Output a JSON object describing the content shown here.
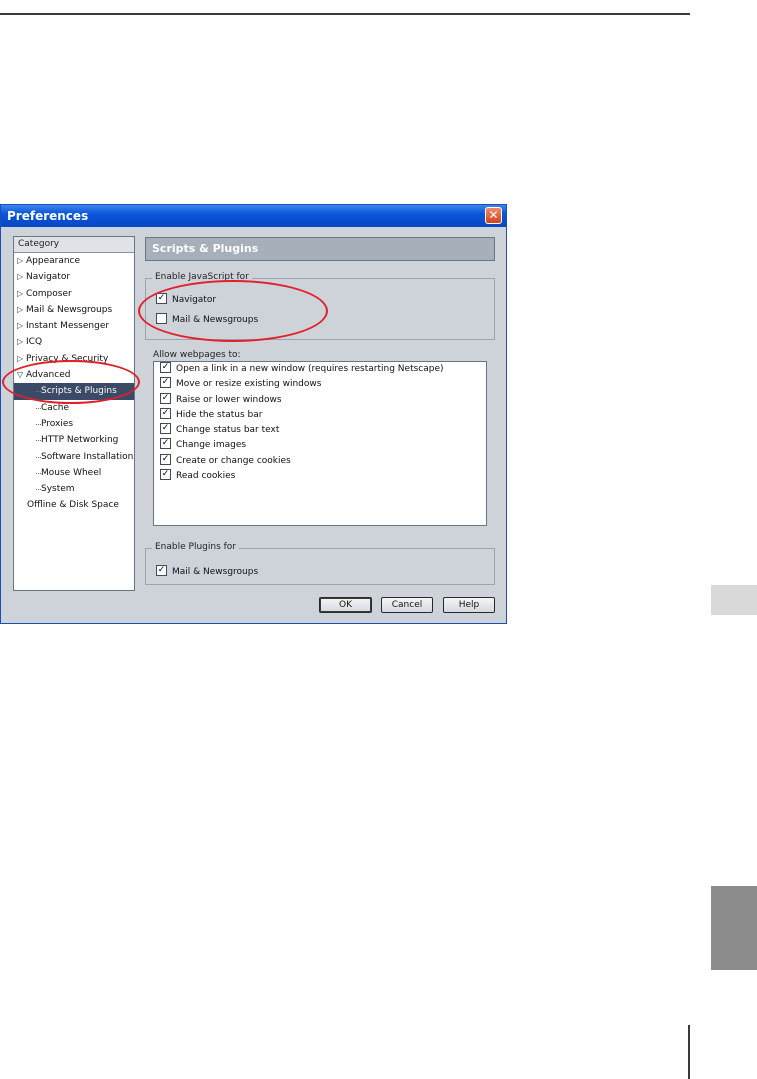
{
  "window": {
    "title": "Preferences"
  },
  "category": {
    "header": "Category",
    "items": [
      {
        "label": "Appearance",
        "kind": "collapsed"
      },
      {
        "label": "Navigator",
        "kind": "collapsed"
      },
      {
        "label": "Composer",
        "kind": "collapsed"
      },
      {
        "label": "Mail & Newsgroups",
        "kind": "collapsed"
      },
      {
        "label": "Instant Messenger",
        "kind": "collapsed"
      },
      {
        "label": "ICQ",
        "kind": "collapsed"
      },
      {
        "label": "Privacy & Security",
        "kind": "collapsed"
      },
      {
        "label": "Advanced",
        "kind": "expanded"
      },
      {
        "label": "Scripts & Plugins",
        "kind": "child",
        "selected": true
      },
      {
        "label": "Cache",
        "kind": "child"
      },
      {
        "label": "Proxies",
        "kind": "child"
      },
      {
        "label": "HTTP Networking",
        "kind": "child"
      },
      {
        "label": "Software Installation",
        "kind": "child"
      },
      {
        "label": "Mouse Wheel",
        "kind": "child"
      },
      {
        "label": "System",
        "kind": "child"
      },
      {
        "label": "Offline & Disk Space",
        "kind": "plain"
      }
    ]
  },
  "panel": {
    "title": "Scripts & Plugins",
    "enable_js": {
      "legend": "Enable JavaScript for",
      "options": [
        {
          "label": "Navigator",
          "checked": true
        },
        {
          "label": "Mail & Newsgroups",
          "checked": false
        }
      ]
    },
    "allow_label": "Allow webpages to:",
    "allow_items": [
      {
        "label": "Open a link in a new window (requires restarting Netscape)",
        "checked": true
      },
      {
        "label": "Move or resize existing windows",
        "checked": true
      },
      {
        "label": "Raise or lower windows",
        "checked": true
      },
      {
        "label": "Hide the status bar",
        "checked": true
      },
      {
        "label": "Change status bar text",
        "checked": true
      },
      {
        "label": "Change images",
        "checked": true
      },
      {
        "label": "Create or change cookies",
        "checked": true
      },
      {
        "label": "Read cookies",
        "checked": true
      }
    ],
    "plugins": {
      "legend": "Enable Plugins for",
      "option": {
        "label": "Mail & Newsgroups",
        "checked": true
      }
    }
  },
  "buttons": {
    "ok": "OK",
    "cancel": "Cancel",
    "help": "Help"
  },
  "colors": {
    "annotation_ring": "#e0202a",
    "titlebar": "#0a56d8",
    "selection": "#3b4a66"
  }
}
